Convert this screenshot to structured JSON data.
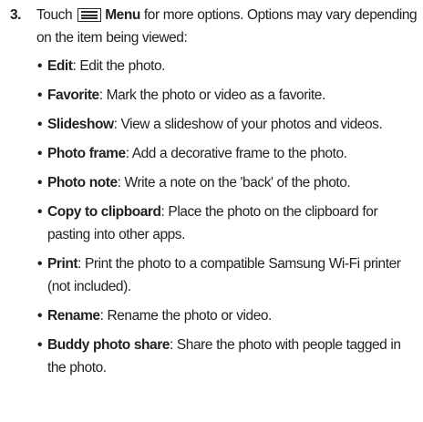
{
  "step": {
    "number": "3.",
    "lead": "Touch",
    "menu_icon": "menu-icon",
    "menu_label": "Menu",
    "rest": " for more options. Options may vary depending on the item being viewed:"
  },
  "options": [
    {
      "term": "Edit",
      "desc": ": Edit the photo."
    },
    {
      "term": "Favorite",
      "desc": ": Mark the photo or video as a favorite."
    },
    {
      "term": "Slideshow",
      "desc": ": View a slideshow of your photos and videos."
    },
    {
      "term": "Photo frame",
      "desc": ": Add a decorative frame to the photo."
    },
    {
      "term": "Photo note",
      "desc": ": Write a note on the 'back' of the photo."
    },
    {
      "term": "Copy to clipboard",
      "desc": ": Place the photo on the clipboard for pasting into other apps."
    },
    {
      "term": "Print",
      "desc": ": Print the photo to a compatible Samsung Wi-Fi printer (not included)."
    },
    {
      "term": "Rename",
      "desc": ": Rename the photo or video."
    },
    {
      "term": "Buddy photo share",
      "desc": ": Share the photo with people tagged in the photo."
    }
  ]
}
